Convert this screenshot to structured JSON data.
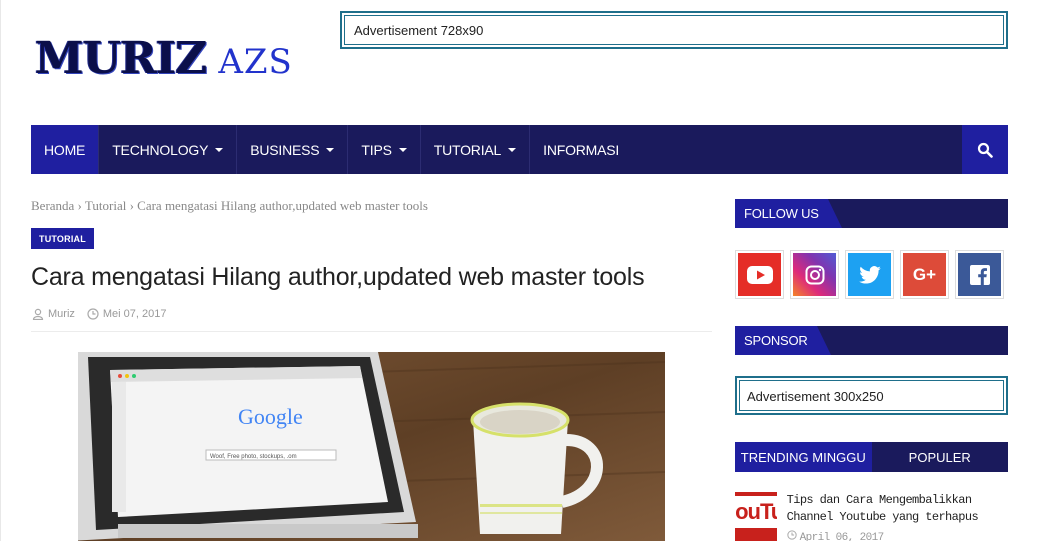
{
  "header": {
    "logo_main": "MURIZ",
    "logo_sub": "AZS",
    "ad_top": "Advertisement 728x90"
  },
  "nav": {
    "items": [
      {
        "label": "HOME",
        "dropdown": false,
        "active": true
      },
      {
        "label": "TECHNOLOGY",
        "dropdown": true
      },
      {
        "label": "BUSINESS",
        "dropdown": true
      },
      {
        "label": "TIPS",
        "dropdown": true
      },
      {
        "label": "TUTORIAL",
        "dropdown": true
      },
      {
        "label": "INFORMASI",
        "dropdown": false
      }
    ],
    "search_icon": "search-icon"
  },
  "post": {
    "breadcrumb": "Beranda › Tutorial › Cara mengatasi Hilang author,updated web master tools",
    "label": "TUTORIAL",
    "title": "Cara mengatasi Hilang author,updated web master tools",
    "author": "Muriz",
    "date": "Mei 07, 2017",
    "image_text": {
      "brand": "Google",
      "query": "Woof, Free photo, stockups, .om"
    }
  },
  "sidebar": {
    "follow_title": "FOLLOW US",
    "social": [
      {
        "name": "youtube-icon",
        "color": "#e52d27"
      },
      {
        "name": "instagram-icon",
        "color": "#b4359f"
      },
      {
        "name": "twitter-icon",
        "color": "#1da1f2"
      },
      {
        "name": "google-plus-icon",
        "color": "#dd4b39"
      },
      {
        "name": "facebook-icon",
        "color": "#3b5998"
      }
    ],
    "sponsor_title": "SPONSOR",
    "ad_side": "Advertisement 300x250",
    "tabs": [
      "TRENDING MINGGU",
      "POPULER"
    ],
    "trending": {
      "title": "Tips dan Cara Mengembalikkan Channel Youtube yang terhapus",
      "date": "April 06, 2017",
      "thumb_text": "ouTube"
    }
  },
  "colors": {
    "nav_bg": "#1a1a5c",
    "accent": "#1f1fa0"
  }
}
